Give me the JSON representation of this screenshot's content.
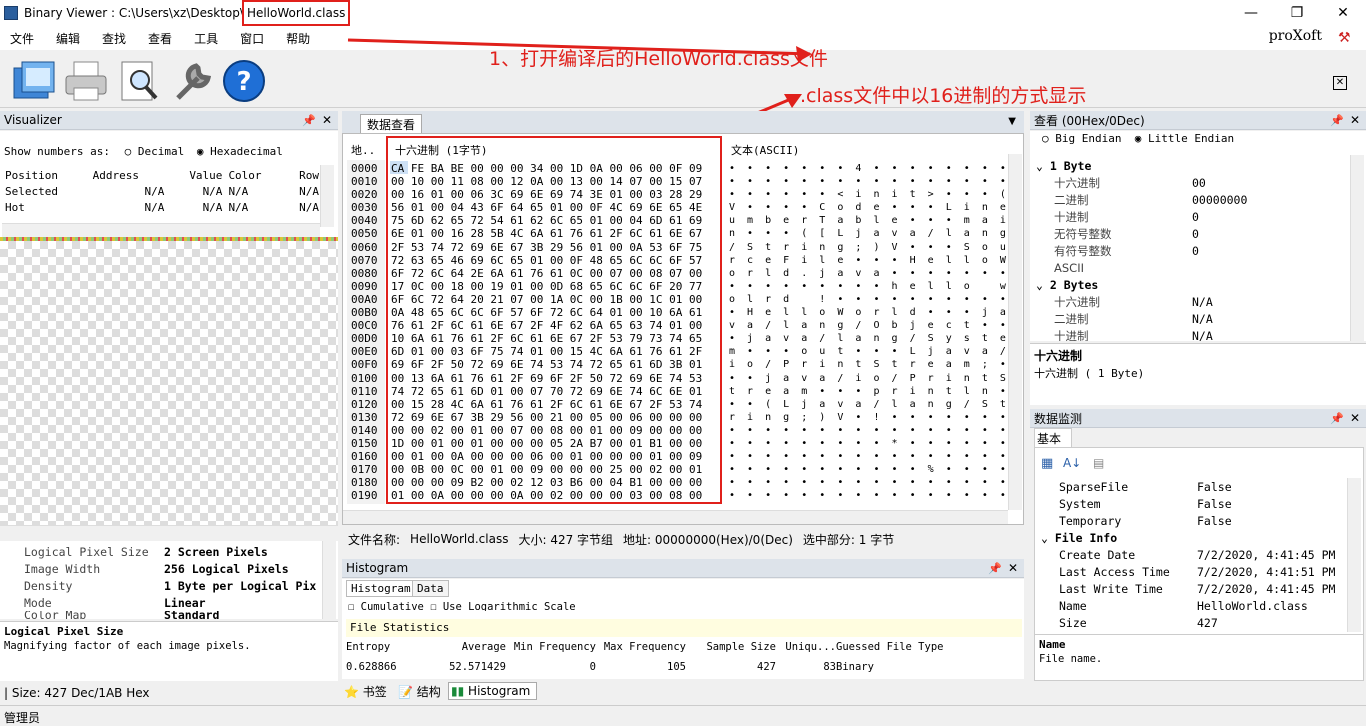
{
  "title": {
    "prefix": "Binary Viewer : C:\\Users\\xz\\Desktop\\",
    "file": "HelloWorld.class"
  },
  "window_buttons": [
    "—",
    "❐",
    "✕"
  ],
  "menu": [
    "文件",
    "编辑",
    "查找",
    "查看",
    "工具",
    "窗口",
    "帮助"
  ],
  "logo": "proXoft",
  "annotations": {
    "a1": "1、打开编译后的HelloWorld.class文件",
    "a2": ".class文件中以16进制的方式显示"
  },
  "visualizer": {
    "title": "Visualizer",
    "show_label": "Show numbers as:",
    "opt_dec": "Decimal",
    "opt_hex": "Hexadecimal",
    "headers": [
      "Position",
      "Address",
      "Value",
      "Color",
      "Row"
    ],
    "rows": [
      [
        "Selected",
        "N/A",
        "N/A",
        "N/A",
        "N/A"
      ],
      [
        "Hot",
        "N/A",
        "N/A",
        "N/A",
        "N/A"
      ]
    ],
    "props": [
      [
        "Logical Pixel Size",
        "2 Screen Pixels"
      ],
      [
        "Image Width",
        "256 Logical Pixels"
      ],
      [
        "Density",
        "1 Byte per Logical Pix"
      ],
      [
        "Mode",
        "Linear"
      ],
      [
        "Color Map",
        "Standard"
      ]
    ],
    "desc_title": "Logical Pixel Size",
    "desc_text": "Magnifying factor of each image pixels."
  },
  "hexview": {
    "tab": "数据查看",
    "col_addr": "地..",
    "col_hex": "十六进制 (1字节)",
    "col_text": "文本(ASCII)",
    "addrs": [
      "0000",
      "0010",
      "0020",
      "0030",
      "0040",
      "0050",
      "0060",
      "0070",
      "0080",
      "0090",
      "00A0",
      "00B0",
      "00C0",
      "00D0",
      "00E0",
      "00F0",
      "0100",
      "0110",
      "0120",
      "0130",
      "0140",
      "0150",
      "0160",
      "0170",
      "0180",
      "0190"
    ],
    "hex": [
      "CA FE BA BE 00 00 00 34 00 1D 0A 00 06 00 0F 09",
      "00 10 00 11 08 00 12 0A 00 13 00 14 07 00 15 07",
      "00 16 01 00 06 3C 69 6E 69 74 3E 01 00 03 28 29",
      "56 01 00 04 43 6F 64 65 01 00 0F 4C 69 6E 65 4E",
      "75 6D 62 65 72 54 61 62 6C 65 01 00 04 6D 61 69",
      "6E 01 00 16 28 5B 4C 6A 61 76 61 2F 6C 61 6E 67",
      "2F 53 74 72 69 6E 67 3B 29 56 01 00 0A 53 6F 75",
      "72 63 65 46 69 6C 65 01 00 0F 48 65 6C 6C 6F 57",
      "6F 72 6C 64 2E 6A 61 76 61 0C 00 07 00 08 07 00",
      "17 0C 00 18 00 19 01 00 0D 68 65 6C 6C 6F 20 77",
      "6F 6C 72 64 20 21 07 00 1A 0C 00 1B 00 1C 01 00",
      "0A 48 65 6C 6C 6F 57 6F 72 6C 64 01 00 10 6A 61",
      "76 61 2F 6C 61 6E 67 2F 4F 62 6A 65 63 74 01 00",
      "10 6A 61 76 61 2F 6C 61 6E 67 2F 53 79 73 74 65",
      "6D 01 00 03 6F 75 74 01 00 15 4C 6A 61 76 61 2F",
      "69 6F 2F 50 72 69 6E 74 53 74 72 65 61 6D 3B 01",
      "00 13 6A 61 76 61 2F 69 6F 2F 50 72 69 6E 74 53",
      "74 72 65 61 6D 01 00 07 70 72 69 6E 74 6C 6E 01",
      "00 15 28 4C 6A 61 76 61 2F 6C 61 6E 67 2F 53 74",
      "72 69 6E 67 3B 29 56 00 21 00 05 00 06 00 00 00",
      "00 00 02 00 01 00 07 00 08 00 01 00 09 00 00 00",
      "1D 00 01 00 01 00 00 00 05 2A B7 00 01 B1 00 00",
      "00 01 00 0A 00 00 00 06 00 01 00 00 00 01 00 09",
      "00 0B 00 0C 00 01 00 09 00 00 00 25 00 02 00 01",
      "00 00 00 09 B2 00 02 12 03 B6 00 04 B1 00 00 00",
      "01 00 0A 00 00 00 0A 00 02 00 00 00 03 00 08 00"
    ],
    "ascii": [
      "•  •  •  •  •  •  •  4  •  •  •  •  •  •  •  •",
      "•  •  •  •  •  •  •  •  •  •  •  •  •  •  •  •",
      "•  •  •  •  •  •  <  i  n  i  t  >  •  •  •  (",
      "V  •  •  •  •  C  o  d  e  •  •  •  L  i  n  e",
      "u  m  b  e  r  T  a  b  l  e  •  •  •  m  a  i",
      "n  •  •  •  (  [  L  j  a  v  a  /  l  a  n  g",
      "/  S  t  r  i  n  g  ;  )  V  •  •  •  S  o  u",
      "r  c  e  F  i  l  e  •  •  •  H  e  l  l  o  W",
      "o  r  l  d  .  j  a  v  a  •  •  •  •  •  •  •",
      "•  •  •  •  •  •  •  •  •  h  e  l  l  o     w",
      "o  l  r  d     !  •  •  •  •  •  •  •  •  •  •",
      "•  H  e  l  l  o  W  o  r  l  d  •  •  •  j  a",
      "v  a  /  l  a  n  g  /  O  b  j  e  c  t  •  •",
      "•  j  a  v  a  /  l  a  n  g  /  S  y  s  t  e",
      "m  •  •  •  o  u  t  •  •  •  L  j  a  v  a  /",
      "i  o  /  P  r  i  n  t  S  t  r  e  a  m  ;  •",
      "•  •  j  a  v  a  /  i  o  /  P  r  i  n  t  S",
      "t  r  e  a  m  •  •  •  p  r  i  n  t  l  n  •",
      "•  •  (  L  j  a  v  a  /  l  a  n  g  /  S  t",
      "r  i  n  g  ;  )  V  •  !  •  •  •  •  •  •  •",
      "•  •  •  •  •  •  •  •  •  •  •  •  •  •  •  •",
      "•  •  •  •  •  •  •  •  •  *  •  •  •  •  •  •",
      "•  •  •  •  •  •  •  •  •  •  •  •  •  •  •  •",
      "•  •  •  •  •  •  •  •  •  •  •  %  •  •  •  •",
      "•  •  •  •  •  •  •  •  •  •  •  •  •  •  •  •",
      "•  •  •  •  •  •  •  •  •  •  •  •  •  •  •  •"
    ],
    "status": {
      "file_label": "文件名称:",
      "file": "HelloWorld.class",
      "size": "大小: 427 字节组",
      "addr": "地址: 00000000(Hex)/0(Dec)",
      "sel": "选中部分: 1 字节"
    }
  },
  "histogram": {
    "title": "Histogram",
    "tabs": [
      "Histogram",
      "Data"
    ],
    "cb1": "Cumulative",
    "cb2": "Use Logarithmic Scale",
    "stats_title": "File Statistics",
    "headers": [
      "Entropy",
      "Average",
      "Min Frequency",
      "Max Frequency",
      "Sample Size",
      "Uniqu...",
      "Guessed File Type"
    ],
    "values": [
      "0.628866",
      "52.571429",
      "0",
      "105",
      "427",
      "83",
      "Binary"
    ]
  },
  "bottom_tabs": [
    "书签",
    "结构",
    "Histogram"
  ],
  "inspector": {
    "title": "查看 (00Hex/0Dec)",
    "opt_be": "Big Endian",
    "opt_le": "Little Endian",
    "s1": "1 Byte",
    "rows1": [
      [
        "十六进制",
        "00"
      ],
      [
        "二进制",
        "00000000"
      ],
      [
        "十进制",
        "0"
      ],
      [
        "无符号整数",
        "0"
      ],
      [
        "有符号整数",
        "0"
      ],
      [
        "ASCII",
        ""
      ]
    ],
    "s2": "2 Bytes",
    "rows2": [
      [
        "十六进制",
        "N/A"
      ],
      [
        "二进制",
        "N/A"
      ],
      [
        "十进制",
        "N/A"
      ]
    ],
    "desc_title": "十六进制",
    "desc_text": "十六进制 ( 1 Byte)"
  },
  "monitor": {
    "title": "数据监测",
    "tab": "基本",
    "rows": [
      [
        "SparseFile",
        "False"
      ],
      [
        "System",
        "False"
      ],
      [
        "Temporary",
        "False"
      ]
    ],
    "section": "File Info",
    "info": [
      [
        "Create Date",
        "7/2/2020, 4:41:45 PM"
      ],
      [
        "Last Access Time",
        "7/2/2020, 4:41:51 PM"
      ],
      [
        "Last Write Time",
        "7/2/2020, 4:41:45 PM"
      ],
      [
        "Name",
        "HelloWorld.class"
      ],
      [
        "Size",
        "427"
      ]
    ],
    "desc_title": "Name",
    "desc_text": "File name."
  },
  "statusbar": {
    "left": "| Size: 427 Dec/1AB Hex",
    "user": "管理员"
  },
  "colors": {
    "accent": "#e0201b",
    "panel": "#dde3ea"
  }
}
